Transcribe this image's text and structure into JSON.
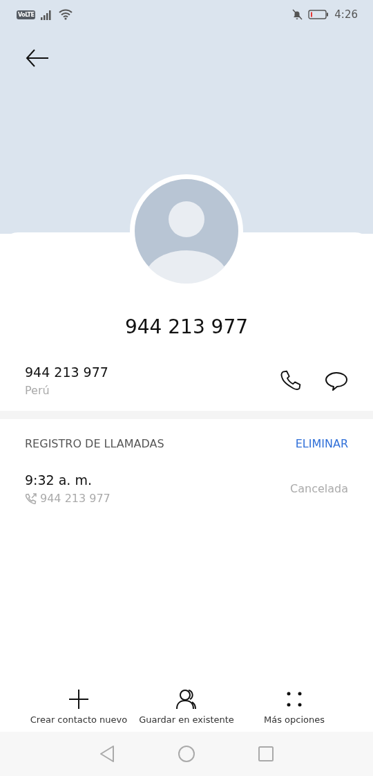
{
  "status_bar": {
    "network_badge": "VoLTE",
    "time": "4:26"
  },
  "contact": {
    "title": "944 213 977",
    "number": "944 213 977",
    "country": "Perú"
  },
  "call_log": {
    "heading": "REGISTRO DE LLAMADAS",
    "action": "ELIMINAR",
    "entries": [
      {
        "time": "9:32 a. m.",
        "number": "944 213 977",
        "status": "Cancelada"
      }
    ]
  },
  "actions": [
    {
      "kind": "add",
      "label": "Crear contacto nuevo"
    },
    {
      "kind": "person",
      "label": "Guardar en existente"
    },
    {
      "kind": "more",
      "label": "Más opciones"
    }
  ]
}
